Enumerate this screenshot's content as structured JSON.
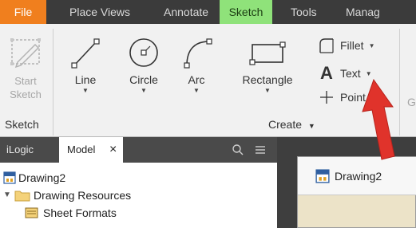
{
  "ribbon_tabs": [
    "File",
    "Place Views",
    "Annotate",
    "Sketch",
    "Tools",
    "Manag"
  ],
  "sketch_panel": {
    "start_sketch_label": "Start\nSketch",
    "title": "Sketch"
  },
  "create_panel": {
    "line_label": "Line",
    "circle_label": "Circle",
    "arc_label": "Arc",
    "rectangle_label": "Rectangle",
    "fillet_label": "Fillet",
    "text_label": "Text",
    "point_label": "Point",
    "title": "Create"
  },
  "next_panel_partial": "G",
  "browser": {
    "tabs": [
      "iLogic",
      "Model"
    ],
    "close_glyph": "×",
    "tree": [
      "Drawing2",
      "Drawing Resources",
      "Sheet Formats"
    ]
  },
  "document_window": {
    "title": "Drawing2"
  },
  "colors": {
    "file_tab": "#f07f1e",
    "active_tab": "#8fe27a",
    "annotation_arrow": "#e0332b",
    "ribbon_bg": "#f1f1f1"
  }
}
